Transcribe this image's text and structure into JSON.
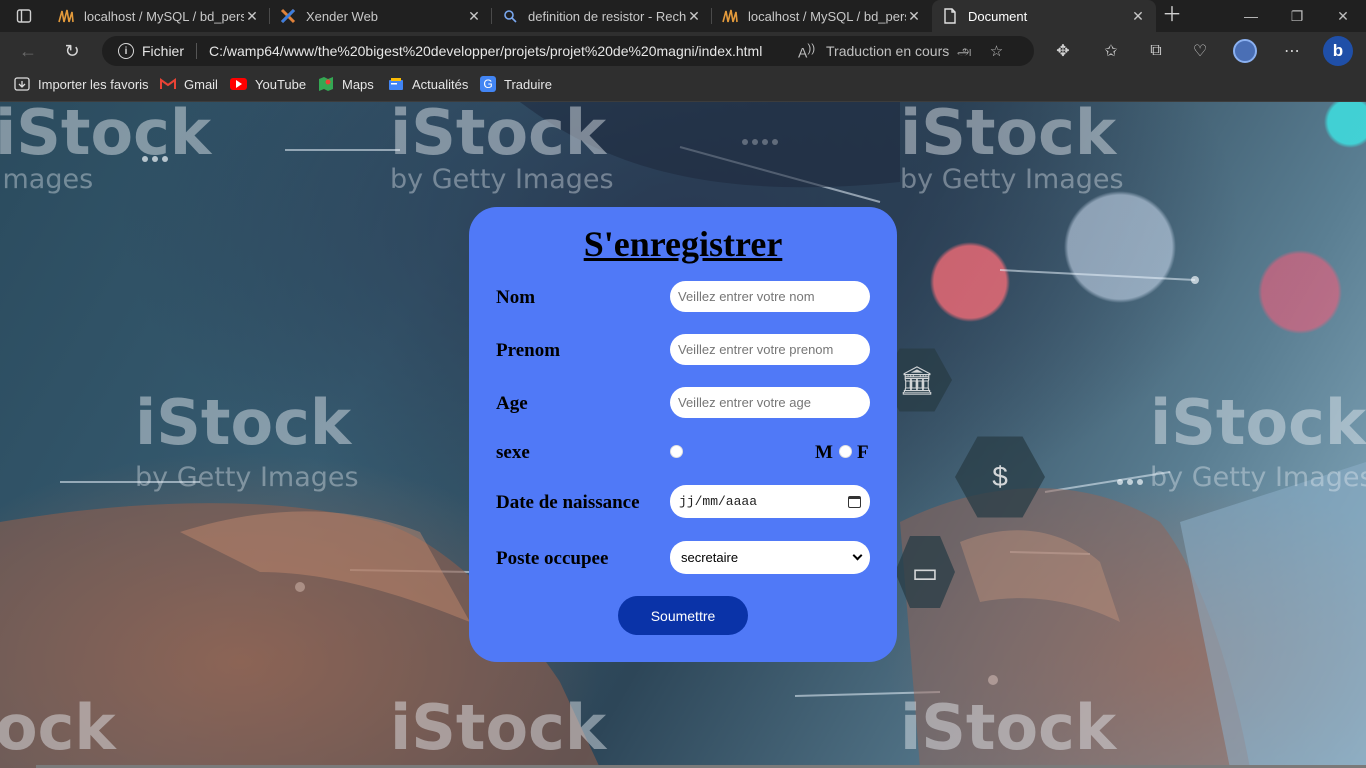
{
  "browser": {
    "tabs": [
      {
        "title": "localhost / MySQL / bd_personnel",
        "favicon": "phpmyadmin-icon",
        "closable": true
      },
      {
        "title": "Xender Web",
        "favicon": "xender-icon",
        "closable": true
      },
      {
        "title": "definition de resistor - Recherche",
        "favicon": "search-icon",
        "closable": true
      },
      {
        "title": "localhost / MySQL / bd_personnel",
        "favicon": "phpmyadmin-icon",
        "closable": true
      },
      {
        "title": "Document",
        "favicon": "document-icon",
        "closable": true,
        "active": true
      }
    ],
    "address": {
      "scheme_label": "Fichier",
      "url": "C:/wamp64/www/the%20bigest%20developper/projets/projet%20de%20magni/index.html",
      "translate_status": "Traduction en cours"
    },
    "bookmarks": [
      {
        "label": "Importer les favoris",
        "icon": "import-icon"
      },
      {
        "label": "Gmail",
        "icon": "gmail-icon"
      },
      {
        "label": "YouTube",
        "icon": "youtube-icon"
      },
      {
        "label": "Maps",
        "icon": "maps-icon"
      },
      {
        "label": "Actualités",
        "icon": "news-icon"
      },
      {
        "label": "Traduire",
        "icon": "translate-icon"
      }
    ]
  },
  "background": {
    "watermark": "iStock",
    "watermark_sub": "by Getty Images"
  },
  "form": {
    "title": "S'enregistrer",
    "fields": {
      "nom": {
        "label": "Nom",
        "placeholder": "Veillez entrer votre nom"
      },
      "prenom": {
        "label": "Prenom",
        "placeholder": "Veillez entrer votre prenom"
      },
      "age": {
        "label": "Age",
        "placeholder": "Veillez entrer votre age"
      },
      "sexe": {
        "label": "sexe",
        "option_m": "M",
        "option_f": "F"
      },
      "date": {
        "label": "Date de naissance",
        "placeholder": "jj/mm/aaaa"
      },
      "poste": {
        "label": "Poste occupee",
        "selected": "secretaire"
      }
    },
    "submit_label": "Soumettre",
    "colors": {
      "card": "#5079f7",
      "button": "#0a33a8"
    }
  }
}
